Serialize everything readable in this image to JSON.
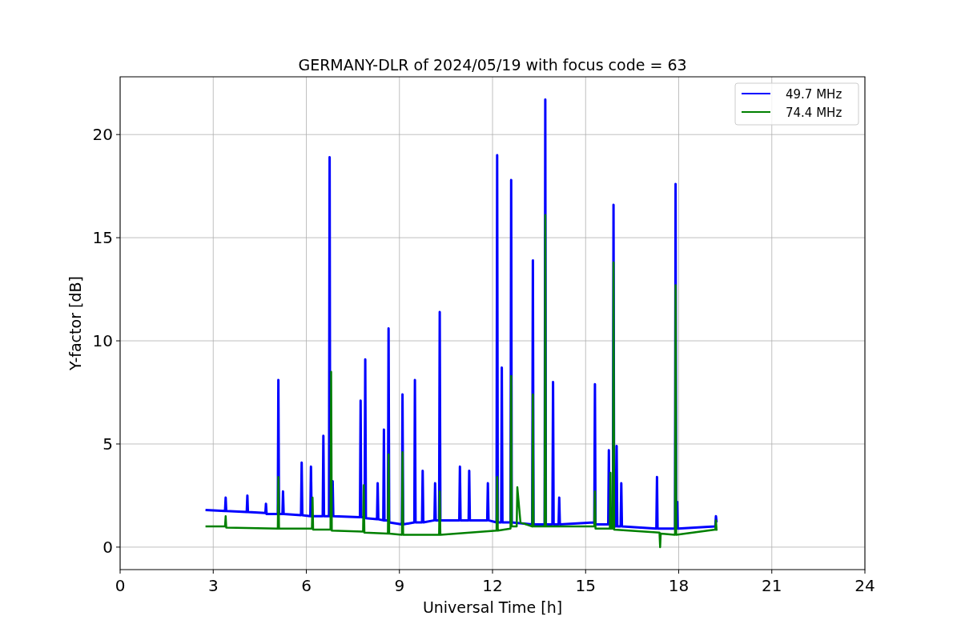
{
  "chart_data": {
    "type": "line",
    "title": "GERMANY-DLR of 2024/05/19 with focus code = 63",
    "xlabel": "Universal Time [h]",
    "ylabel": "Y-factor [dB]",
    "xlim": [
      0,
      24
    ],
    "ylim": [
      -1.09,
      22.8
    ],
    "xticks": [
      0,
      3,
      6,
      9,
      12,
      15,
      18,
      21,
      24
    ],
    "yticks": [
      0,
      5,
      10,
      15,
      20
    ],
    "grid": true,
    "legend": true,
    "series": [
      {
        "name": "49.7 MHz",
        "color": "#0000ff",
        "x": [
          2.75,
          3.38,
          3.4,
          3.42,
          4.08,
          4.1,
          4.12,
          4.68,
          4.7,
          4.72,
          5.08,
          5.1,
          5.12,
          5.23,
          5.25,
          5.27,
          5.83,
          5.85,
          5.87,
          6.13,
          6.15,
          6.17,
          6.53,
          6.55,
          6.57,
          6.73,
          6.75,
          6.77,
          6.83,
          6.85,
          6.87,
          7.73,
          7.75,
          7.77,
          7.88,
          7.9,
          7.92,
          8.28,
          8.3,
          8.32,
          8.48,
          8.5,
          8.52,
          8.63,
          8.65,
          8.67,
          9.08,
          9.1,
          9.12,
          9.48,
          9.5,
          9.52,
          9.73,
          9.75,
          9.77,
          10.13,
          10.15,
          10.17,
          10.28,
          10.3,
          10.32,
          10.93,
          10.95,
          10.97,
          11.23,
          11.25,
          11.27,
          11.83,
          11.85,
          11.87,
          12.13,
          12.15,
          12.17,
          12.28,
          12.3,
          12.32,
          12.58,
          12.6,
          12.62,
          13.28,
          13.3,
          13.32,
          13.68,
          13.7,
          13.72,
          13.93,
          13.95,
          13.97,
          14.13,
          14.15,
          14.17,
          15.28,
          15.3,
          15.32,
          15.73,
          15.75,
          15.77,
          15.88,
          15.9,
          15.92,
          15.98,
          16.0,
          16.02,
          16.13,
          16.15,
          16.17,
          17.28,
          17.3,
          17.32,
          17.88,
          17.9,
          17.92,
          17.93,
          17.95,
          17.97,
          19.18,
          19.2,
          19.22
        ],
        "values": [
          1.8,
          1.75,
          2.4,
          1.75,
          1.7,
          2.5,
          1.7,
          1.65,
          2.1,
          1.6,
          1.6,
          8.1,
          1.6,
          1.6,
          2.7,
          1.6,
          1.55,
          4.1,
          1.55,
          1.5,
          3.9,
          1.5,
          1.5,
          5.4,
          1.5,
          1.5,
          18.9,
          1.5,
          1.5,
          3.2,
          1.5,
          1.45,
          7.1,
          1.45,
          1.45,
          9.1,
          1.4,
          1.35,
          3.1,
          1.35,
          1.3,
          5.7,
          1.3,
          1.3,
          10.6,
          1.2,
          1.1,
          7.4,
          1.1,
          1.2,
          8.1,
          1.2,
          1.2,
          3.7,
          1.2,
          1.3,
          3.1,
          1.3,
          1.3,
          11.4,
          1.3,
          1.3,
          3.9,
          1.3,
          1.3,
          3.7,
          1.3,
          1.3,
          3.1,
          1.3,
          1.2,
          19.0,
          1.2,
          1.2,
          8.7,
          1.2,
          1.2,
          17.8,
          1.2,
          1.1,
          13.9,
          1.1,
          1.1,
          21.7,
          1.1,
          1.1,
          8.0,
          1.1,
          1.1,
          2.4,
          1.1,
          1.2,
          7.9,
          1.1,
          1.1,
          4.7,
          1.1,
          1.1,
          16.6,
          1.0,
          1.0,
          4.9,
          1.0,
          1.0,
          3.1,
          1.0,
          0.9,
          3.4,
          0.9,
          0.9,
          17.6,
          0.9,
          0.9,
          2.2,
          0.9,
          1.0,
          1.5,
          1.2
        ]
      },
      {
        "name": "74.4 MHz",
        "color": "#008000",
        "x": [
          2.75,
          3.38,
          3.4,
          3.42,
          5.08,
          5.1,
          5.12,
          6.18,
          6.2,
          6.22,
          6.78,
          6.8,
          6.82,
          7.83,
          7.85,
          7.87,
          8.63,
          8.65,
          8.67,
          9.08,
          9.1,
          9.12,
          10.28,
          10.3,
          10.32,
          12.13,
          12.15,
          12.17,
          12.58,
          12.6,
          12.62,
          12.78,
          12.8,
          12.9,
          13.28,
          13.3,
          13.32,
          13.68,
          13.7,
          13.72,
          15.28,
          15.3,
          15.32,
          15.78,
          15.8,
          15.82,
          15.88,
          15.9,
          15.92,
          17.38,
          17.4,
          17.42,
          17.88,
          17.9,
          17.92,
          19.18,
          19.2,
          19.22
        ],
        "values": [
          1.0,
          1.0,
          1.5,
          0.95,
          0.9,
          3.4,
          0.9,
          0.9,
          2.4,
          0.85,
          0.85,
          8.5,
          0.8,
          0.75,
          3.0,
          0.7,
          0.65,
          4.5,
          0.65,
          0.6,
          4.6,
          0.6,
          0.6,
          2.7,
          0.6,
          0.8,
          3.4,
          0.8,
          0.9,
          8.3,
          1.0,
          1.0,
          2.9,
          1.2,
          1.0,
          7.4,
          1.0,
          1.0,
          16.1,
          1.0,
          1.0,
          2.7,
          0.9,
          0.9,
          3.6,
          0.9,
          0.9,
          13.8,
          0.85,
          0.7,
          0.0,
          0.65,
          0.6,
          12.7,
          0.6,
          0.85,
          1.3,
          0.8
        ]
      }
    ]
  }
}
